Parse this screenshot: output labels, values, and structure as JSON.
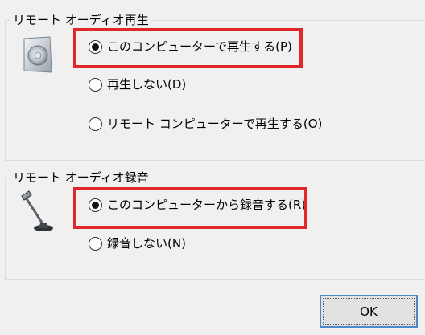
{
  "playback": {
    "title": "リモート オーディオ再生",
    "icon": "speaker-icon",
    "options": [
      {
        "label": "このコンピューターで再生する(P)",
        "checked": true
      },
      {
        "label": "再生しない(D)",
        "checked": false
      },
      {
        "label": "リモート コンピューターで再生する(O)",
        "checked": false
      }
    ]
  },
  "recording": {
    "title": "リモート オーディオ録音",
    "icon": "microphone-icon",
    "options": [
      {
        "label": "このコンピューターから録音する(R)",
        "checked": true
      },
      {
        "label": "録音しない(N)",
        "checked": false
      }
    ]
  },
  "buttons": {
    "ok_label": "OK"
  },
  "colors": {
    "highlight": "#e0282a",
    "focus_border": "#4a86c8",
    "background": "#f0f0f0"
  }
}
